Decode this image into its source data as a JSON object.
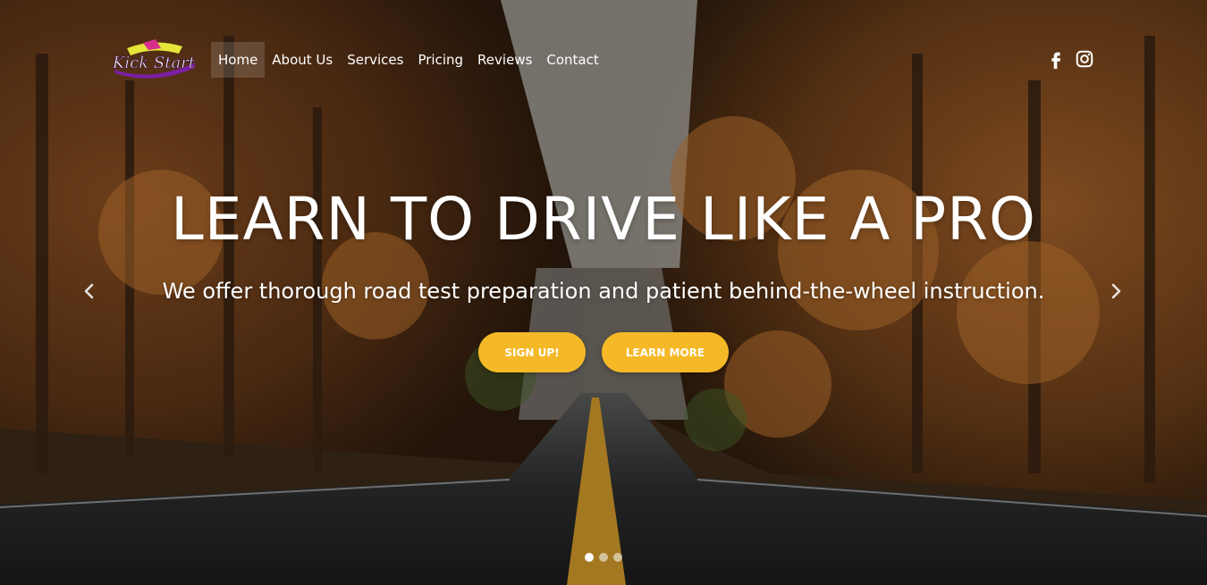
{
  "brand": {
    "logo_text": "Kick Start"
  },
  "nav": {
    "items": [
      {
        "label": "Home",
        "active": true
      },
      {
        "label": "About Us"
      },
      {
        "label": "Services"
      },
      {
        "label": "Pricing"
      },
      {
        "label": "Reviews"
      },
      {
        "label": "Contact"
      }
    ]
  },
  "social": {
    "icons": [
      "facebook-icon",
      "instagram-icon"
    ]
  },
  "hero": {
    "headline": "LEARN TO DRIVE LIKE A PRO",
    "subline": "We offer thorough road test preparation and patient behind-the-wheel instruction.",
    "signup_label": "SIGN UP!",
    "learn_label": "LEARN MORE",
    "accent_color": "#f5b928"
  },
  "carousel": {
    "slides": 3,
    "active_slide": 1
  }
}
